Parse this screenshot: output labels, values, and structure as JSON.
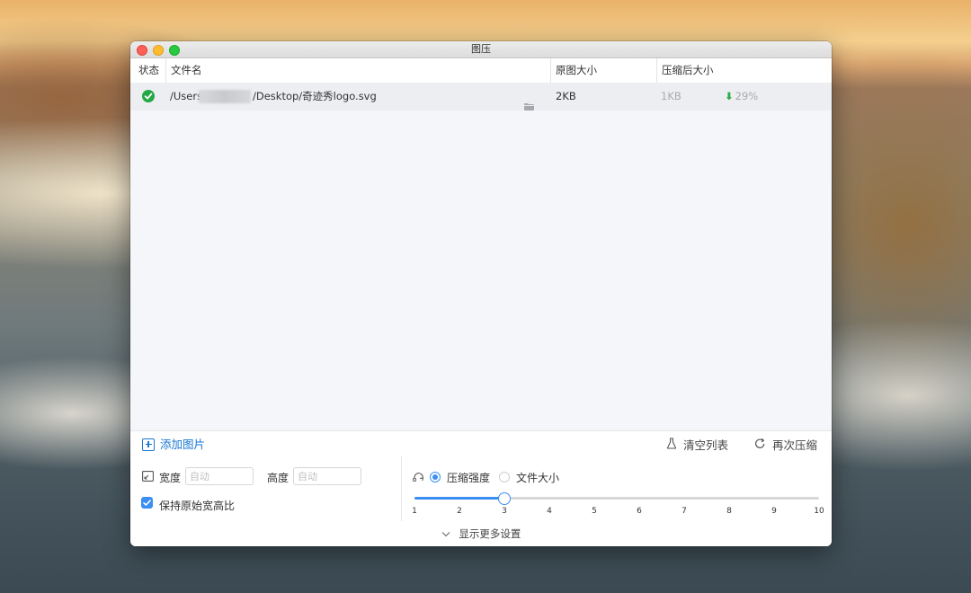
{
  "window": {
    "title": "图压"
  },
  "table": {
    "headers": {
      "status": "状态",
      "filename": "文件名",
      "original_size": "原图大小",
      "compressed_size": "压缩后大小"
    },
    "rows": [
      {
        "status": "done",
        "path_prefix": "/Users/",
        "path_suffix": "/Desktop/奇迹秀logo.svg",
        "original_size": "2KB",
        "compressed_size": "1KB",
        "saved": "29%"
      }
    ]
  },
  "actions": {
    "add": "添加图片",
    "clear": "清空列表",
    "recompress": "再次压缩"
  },
  "settings": {
    "width_label": "宽度",
    "width_placeholder": "自动",
    "height_label": "高度",
    "height_placeholder": "自动",
    "keep_ratio_label": "保持原始宽高比",
    "keep_ratio_checked": true,
    "mode_options": [
      "压缩强度",
      "文件大小"
    ],
    "mode_selected": "压缩强度",
    "slider": {
      "min": 1,
      "max": 10,
      "value": 3,
      "ticks": [
        "1",
        "2",
        "3",
        "4",
        "5",
        "6",
        "7",
        "8",
        "9",
        "10"
      ]
    }
  },
  "footer": {
    "more_settings": "显示更多设置"
  },
  "colors": {
    "accent": "#3b8ff3",
    "success": "#23a845",
    "link": "#1677d2"
  }
}
